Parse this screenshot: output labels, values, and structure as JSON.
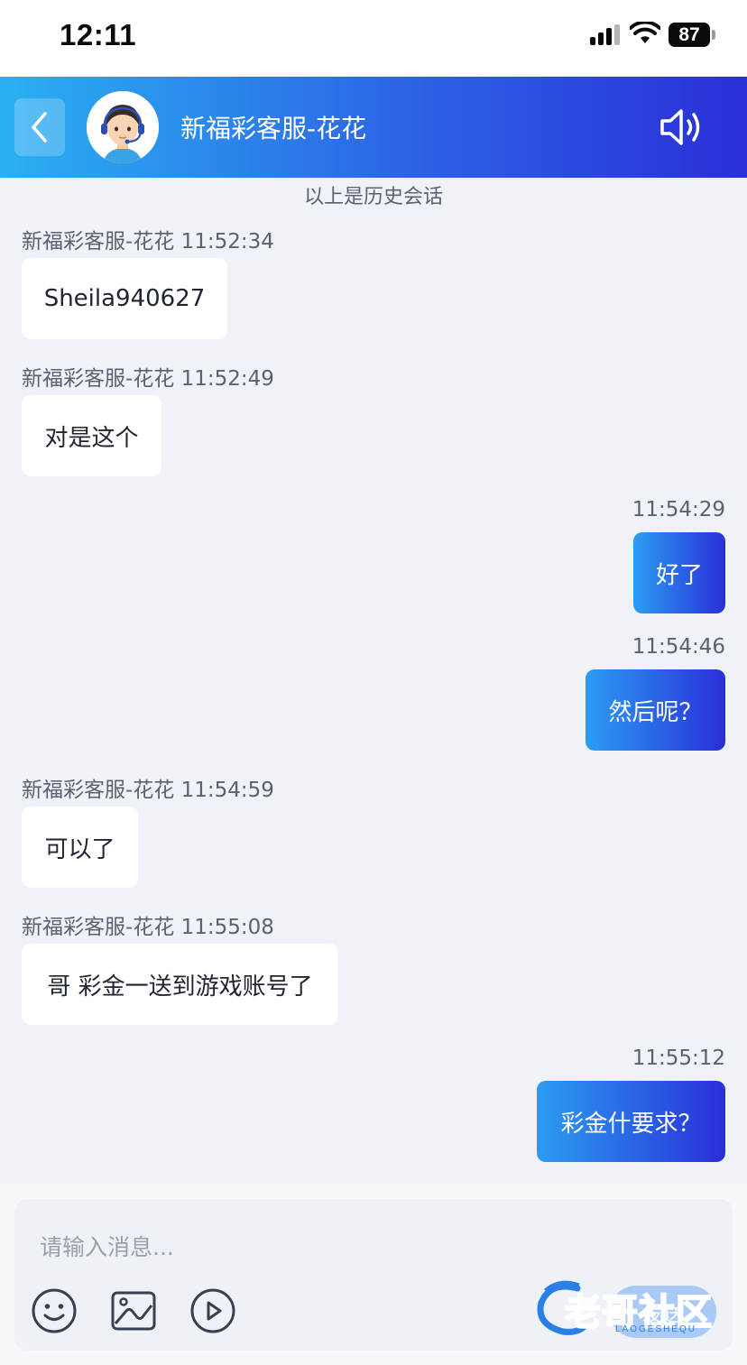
{
  "status_bar": {
    "time": "12:11",
    "battery": "87"
  },
  "header": {
    "title": "新福彩客服-花花",
    "gradient_start": "#2ab0f2",
    "gradient_end": "#2a2fd9",
    "back_icon": "chevron-left-icon",
    "sound_icon": "speaker-icon"
  },
  "history_label": "以上是历史会话",
  "messages": [
    {
      "direction": "in",
      "meta": "新福彩客服-花花 11:52:34",
      "text": "Sheila940627"
    },
    {
      "direction": "in",
      "meta": "新福彩客服-花花 11:52:49",
      "text": "对是这个"
    },
    {
      "direction": "out",
      "meta": "11:54:29",
      "text": "好了"
    },
    {
      "direction": "out",
      "meta": "11:54:46",
      "text": "然后呢？"
    },
    {
      "direction": "in",
      "meta": "新福彩客服-花花 11:54:59",
      "text": "可以了"
    },
    {
      "direction": "in",
      "meta": "新福彩客服-花花 11:55:08",
      "text": "哥 彩金一送到游戏账号了"
    },
    {
      "direction": "out",
      "meta": "11:55:12",
      "text": "彩金什要求？"
    }
  ],
  "composer": {
    "placeholder": "请输入消息...",
    "send_label": "发送",
    "tools": [
      "emoji-icon",
      "image-icon",
      "video-icon"
    ]
  },
  "watermark": {
    "text": "老哥社区",
    "sub": "LAOGESHEQU"
  }
}
